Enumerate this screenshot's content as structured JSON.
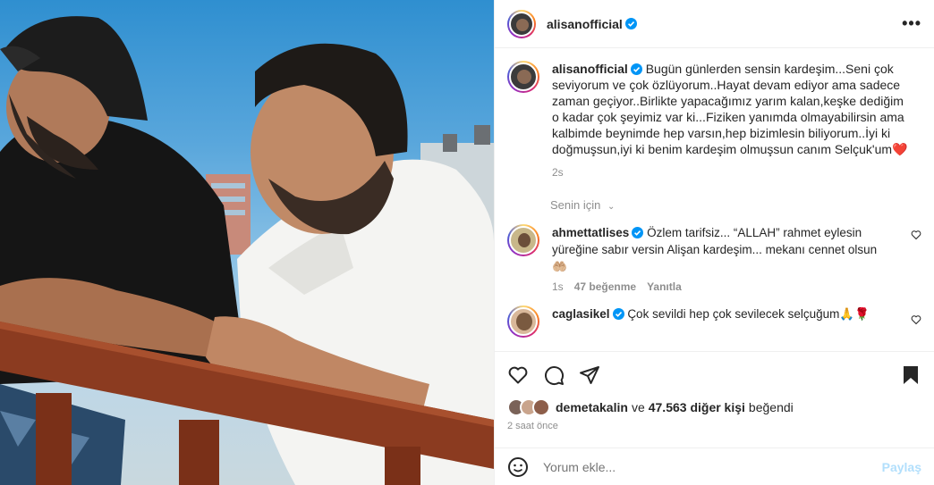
{
  "post": {
    "username": "alisanofficial",
    "more_icon": "more-horizontal-icon",
    "caption": "Bugün günlerden sensin kardeşim...Seni çok seviyorum ve çok özlüyorum..Hayat devam ediyor ama sadece zaman geçiyor..Birlikte yapacağımız yarım kalan,keşke dediğim o kadar çok şeyimiz var ki...Fiziken yanımda olmayabilirsin ama kalbimde beynimde hep varsın,hep bizimlesin biliyorum..İyi ki doğmuşsun,iyi ki benim kardeşim olmuşsun canım Selçuk'um",
    "caption_emoji": "❤️",
    "caption_time": "2s"
  },
  "comments_header": "Senin için",
  "comments": [
    {
      "username": "ahmettatlises",
      "text": "Özlem tarifsiz... “ALLAH” rahmet eylesin yüreğine sabır versin Alişan kardeşim... mekanı cennet olsun",
      "emoji": "🤲🏼",
      "time": "1s",
      "likes": "47 beğenme",
      "reply": "Yanıtla"
    },
    {
      "username": "caglasikel",
      "text": "Çok sevildi hep çok sevilecek selçuğum",
      "emoji": "🙏🌹"
    }
  ],
  "likes": {
    "first_user": "demetakalin",
    "connector": "ve",
    "others": "47.563 diğer kişi",
    "suffix": "beğendi"
  },
  "posted_ago": "2 saat önce",
  "add_comment": {
    "placeholder": "Yorum ekle...",
    "share_label": "Paylaş"
  },
  "colors": {
    "verified": "#0095f6",
    "link_disabled": "#b2dffc",
    "secondary_text": "#8e8e8e"
  }
}
